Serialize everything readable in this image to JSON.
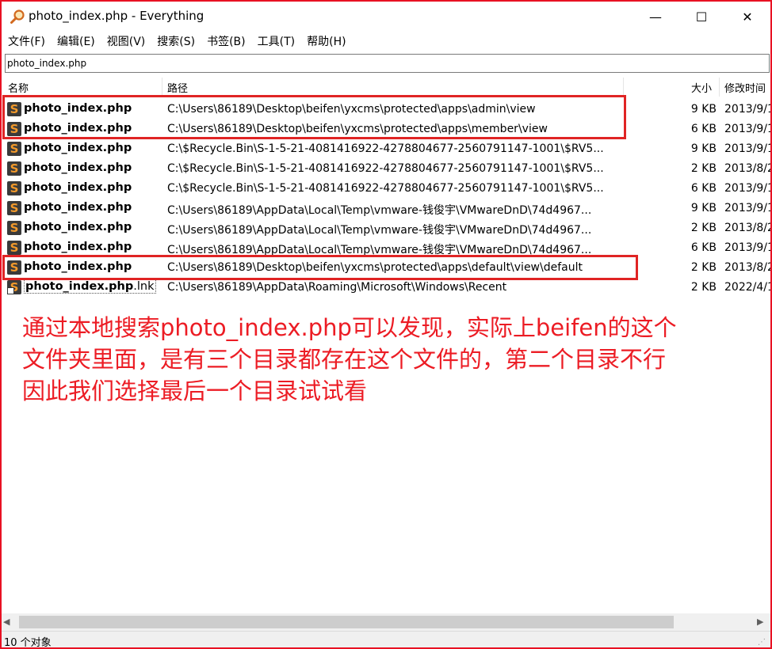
{
  "window": {
    "title": "photo_index.php - Everything",
    "controls": {
      "minimize": "—",
      "maximize": "☐",
      "close": "✕"
    }
  },
  "menu": [
    "文件(F)",
    "编辑(E)",
    "视图(V)",
    "搜索(S)",
    "书签(B)",
    "工具(T)",
    "帮助(H)"
  ],
  "search": {
    "value": "photo_index.php"
  },
  "columns": {
    "name": "名称",
    "path": "路径",
    "size": "大小",
    "modified": "修改时间"
  },
  "rows": [
    {
      "name": "photo_index.php",
      "ext": "",
      "path": "C:\\Users\\86189\\Desktop\\beifen\\yxcms\\protected\\apps\\admin\\view",
      "size": "9 KB",
      "date": "2013/9/1"
    },
    {
      "name": "photo_index.php",
      "ext": "",
      "path": "C:\\Users\\86189\\Desktop\\beifen\\yxcms\\protected\\apps\\member\\view",
      "size": "6 KB",
      "date": "2013/9/1"
    },
    {
      "name": "photo_index.php",
      "ext": "",
      "path": "C:\\$Recycle.Bin\\S-1-5-21-4081416922-4278804677-2560791147-1001\\$RV5...",
      "size": "9 KB",
      "date": "2013/9/1"
    },
    {
      "name": "photo_index.php",
      "ext": "",
      "path": "C:\\$Recycle.Bin\\S-1-5-21-4081416922-4278804677-2560791147-1001\\$RV5...",
      "size": "2 KB",
      "date": "2013/8/2"
    },
    {
      "name": "photo_index.php",
      "ext": "",
      "path": "C:\\$Recycle.Bin\\S-1-5-21-4081416922-4278804677-2560791147-1001\\$RV5...",
      "size": "6 KB",
      "date": "2013/9/1"
    },
    {
      "name": "photo_index.php",
      "ext": "",
      "path": "C:\\Users\\86189\\AppData\\Local\\Temp\\vmware-钱俊宇\\VMwareDnD\\74d4967...",
      "size": "9 KB",
      "date": "2013/9/1"
    },
    {
      "name": "photo_index.php",
      "ext": "",
      "path": "C:\\Users\\86189\\AppData\\Local\\Temp\\vmware-钱俊宇\\VMwareDnD\\74d4967...",
      "size": "2 KB",
      "date": "2013/8/2"
    },
    {
      "name": "photo_index.php",
      "ext": "",
      "path": "C:\\Users\\86189\\AppData\\Local\\Temp\\vmware-钱俊宇\\VMwareDnD\\74d4967...",
      "size": "6 KB",
      "date": "2013/9/1"
    },
    {
      "name": "photo_index.php",
      "ext": "",
      "path": "C:\\Users\\86189\\Desktop\\beifen\\yxcms\\protected\\apps\\default\\view\\default",
      "size": "2 KB",
      "date": "2013/8/2"
    },
    {
      "name": "photo_index.php",
      "ext": ".lnk",
      "path": "C:\\Users\\86189\\AppData\\Roaming\\Microsoft\\Windows\\Recent",
      "size": "2 KB",
      "date": "2022/4/1"
    }
  ],
  "annotation": {
    "line1": "通过本地搜索photo_index.php可以发现，实际上beifen的这个",
    "line2": "文件夹里面，是有三个目录都存在这个文件的，第二个目录不行",
    "line3": "因此我们选择最后一个目录试试看"
  },
  "scrollbar": {
    "left_arrow": "◀",
    "right_arrow": "▶"
  },
  "status": {
    "text": "10 个对象",
    "grip": "⋰"
  },
  "colors": {
    "highlight": "#e02424",
    "annotation": "#ec1c24",
    "icon_bg": "#3a3a3a",
    "icon_fg": "#f39a2b"
  },
  "icons": {
    "app": "magnifier-icon",
    "file": "sublime-file-icon"
  }
}
